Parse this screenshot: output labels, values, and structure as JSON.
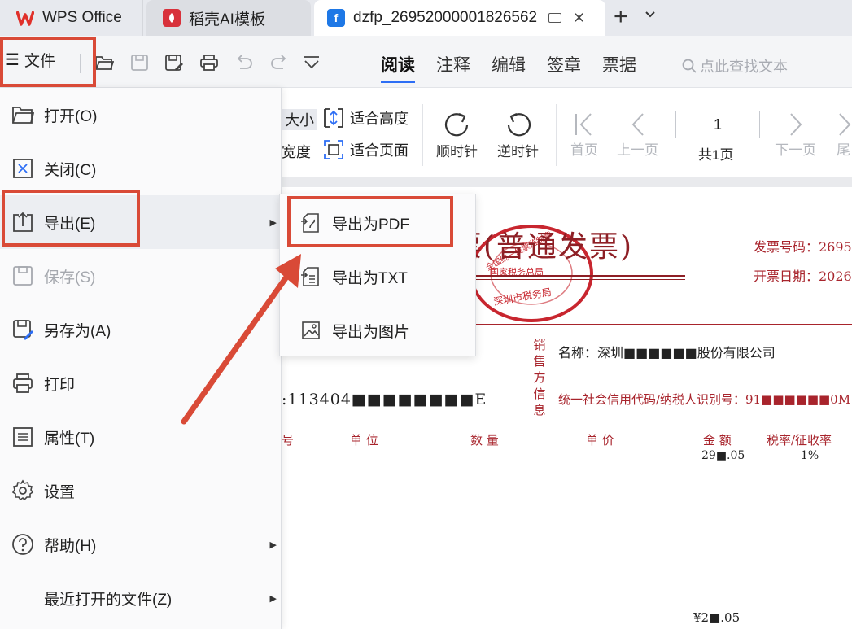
{
  "tabs": {
    "wps_label": "WPS Office",
    "daoke_label": "稻壳AI模板",
    "doc_label": "dzfp_26952000001826562",
    "close_glyph": "✕",
    "new_tab_glyph": "+",
    "tab_list_glyph": "⌄"
  },
  "toolbar": {
    "file_label": "文件",
    "menu_glyph": "☰",
    "view_tabs": [
      "阅读",
      "注释",
      "编辑",
      "签章",
      "票据"
    ],
    "search_placeholder": "点此查找文本"
  },
  "toolbar2": {
    "size_partial": "大小",
    "width_partial": "宽度",
    "fit_height": "适合高度",
    "fit_page": "适合页面",
    "rotate_cw": "顺时针",
    "rotate_ccw": "逆时针",
    "first_page": "首页",
    "prev_page": "上一页",
    "page_number": "1",
    "page_total": "共1页",
    "next_page": "下一页",
    "last_page_partial": "尾"
  },
  "invoice": {
    "title": "(普通发票)",
    "title_prefix": "票",
    "seal_top": "全国统一发票监制章",
    "seal_mid": "国家税务总局",
    "seal_bottom": "深圳市税务局",
    "invoice_no_label": "发票号码：2695",
    "invoice_date_label": "开票日期：2026",
    "seller_vertical": "销售方信息",
    "seller_name": "名称：深圳■■■■■■股份有限公司",
    "seller_tax_id": "统一社会信用代码/纳税人识别号：91■■■■■■0M",
    "buyer_tax_partial": ":113404■■■■■■■■E",
    "col_no": "号",
    "col_unit": "单 位",
    "col_qty": "数 量",
    "col_price": "单 价",
    "col_amount": "金 额",
    "col_tax_rate": "税率/征收率",
    "amount_value": "29■.05",
    "tax_rate_value": "1%",
    "total_value": "¥2■.05"
  },
  "file_menu": {
    "items": [
      {
        "label": "打开(O)",
        "icon": "folder-icon"
      },
      {
        "label": "关闭(C)",
        "icon": "close-box-icon"
      },
      {
        "label": "导出(E)",
        "icon": "export-icon"
      },
      {
        "label": "保存(S)",
        "icon": "save-icon"
      },
      {
        "label": "另存为(A)",
        "icon": "save-as-icon"
      },
      {
        "label": "打印",
        "icon": "print-icon"
      },
      {
        "label": "属性(T)",
        "icon": "properties-icon"
      },
      {
        "label": "设置",
        "icon": "settings-icon"
      },
      {
        "label": "帮助(H)",
        "icon": "help-icon"
      },
      {
        "label": "最近打开的文件(Z)",
        "icon": ""
      }
    ],
    "submenu_arrow": "▶"
  },
  "export_submenu": {
    "items": [
      {
        "label": "导出为PDF",
        "icon": "pdf-export-icon"
      },
      {
        "label": "导出为TXT",
        "icon": "txt-export-icon"
      },
      {
        "label": "导出为图片",
        "icon": "image-export-icon"
      }
    ]
  },
  "colors": {
    "highlight_red": "#d94a37",
    "accent_blue": "#2d6ef5",
    "invoice_red": "#a8242c"
  }
}
